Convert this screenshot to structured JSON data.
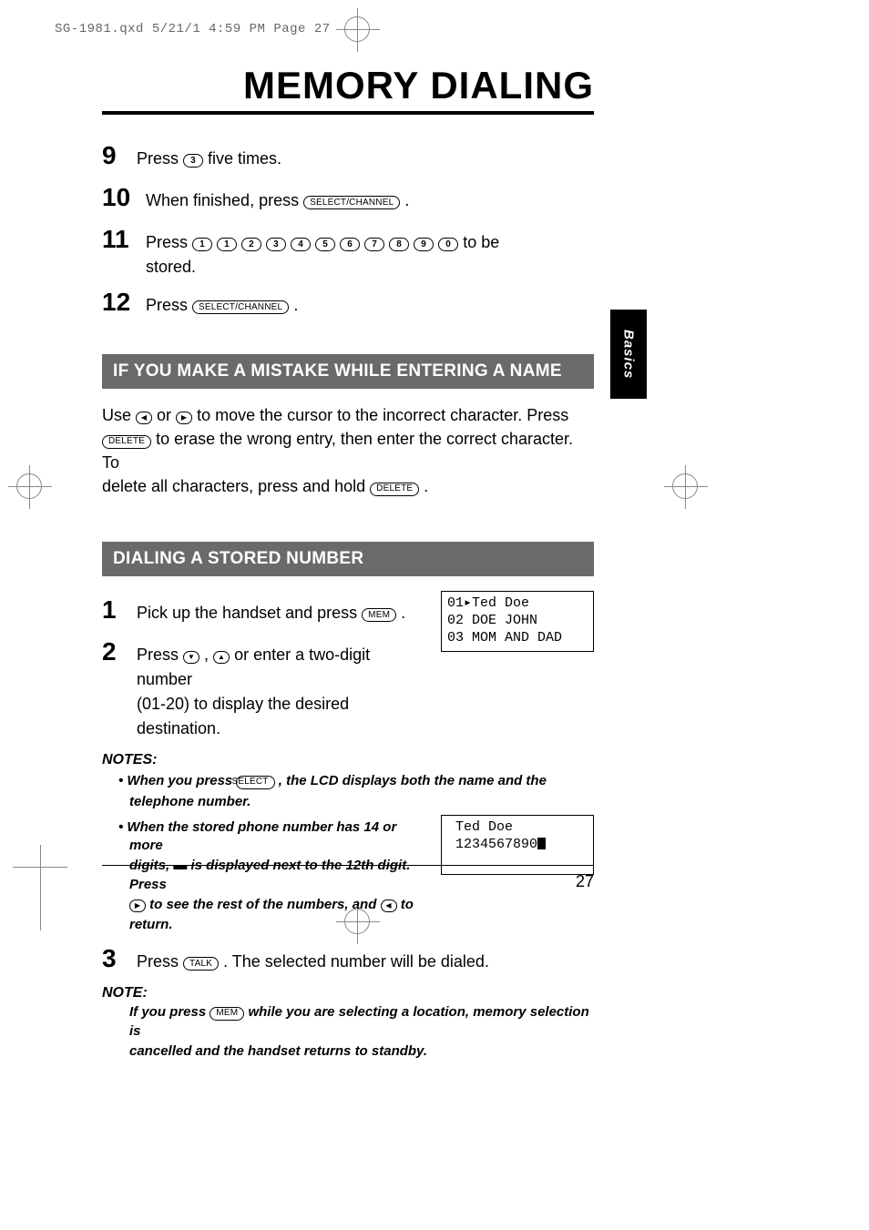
{
  "crop_header": "SG-1981.qxd  5/21/1 4:59 PM  Page 27",
  "title": "MEMORY DIALING",
  "side_tab": "Basics",
  "page_number": "27",
  "steps_top": {
    "s9": {
      "num": "9",
      "a": "Press ",
      "btn": "3",
      "b": " five times."
    },
    "s10": {
      "num": "10",
      "a": "When finished, press ",
      "btn": "SELECT/CHANNEL",
      "b": " ."
    },
    "s11": {
      "num": "11",
      "a": "Press ",
      "digits": [
        "1",
        "1",
        "2",
        "3",
        "4",
        "5",
        "6",
        "7",
        "8",
        "9",
        "0"
      ],
      "b": " to be",
      "c": "stored."
    },
    "s12": {
      "num": "12",
      "a": "Press ",
      "btn": "SELECT/CHANNEL",
      "b": " ."
    }
  },
  "section_mistake": {
    "heading": "IF YOU MAKE A MISTAKE WHILE ENTERING A NAME",
    "l1a": "Use ",
    "l1b": " or ",
    "l1c": " to move the cursor to the incorrect character. Press",
    "btn_delete": "DELETE",
    "l2": " to erase the wrong entry, then enter the correct character. To",
    "l3a": "delete all characters, press and hold ",
    "l3b": " ."
  },
  "section_dialing": {
    "heading": "DIALING A STORED NUMBER",
    "s1": {
      "num": "1",
      "a": "Pick up the handset and press ",
      "btn": "MEM",
      "b": " ."
    },
    "s2": {
      "num": "2",
      "a": "Press ",
      "b": " , ",
      "c": " or enter a two-digit number",
      "d": "(01-20) to display the desired destination."
    },
    "lcd1_l1": "01▸Ted Doe",
    "lcd1_l2": "02 DOE JOHN",
    "lcd1_l3": "03 MOM AND DAD",
    "notes_label": "NOTES:",
    "note1a": "• When you press ",
    "note1_btn": "SELECT",
    "note1b": " , the LCD displays both the name and the",
    "note1c": "telephone number.",
    "note2a": "• When the stored phone number has 14 or more",
    "note2b": "digits, ▬ is displayed next to the 12th digit.  Press",
    "note2c_a": "",
    "note2c_b": " to see the rest of the numbers, and ",
    "note2c_c": " to",
    "note2d": "return.",
    "lcd2_l1": " Ted Doe",
    "lcd2_l2": " 1234567890",
    "s3": {
      "num": "3",
      "a": "Press ",
      "btn": "TALK",
      "b": " .  The selected number will be dialed."
    },
    "note_label2": "NOTE:",
    "note3a": "If you press ",
    "note3_btn": "MEM",
    "note3b": " while you are selecting a location, memory selection is",
    "note3c": "cancelled and the handset returns to standby."
  },
  "arrows": {
    "left": "◀",
    "right": "▶",
    "down": "▼",
    "up": "▲"
  }
}
